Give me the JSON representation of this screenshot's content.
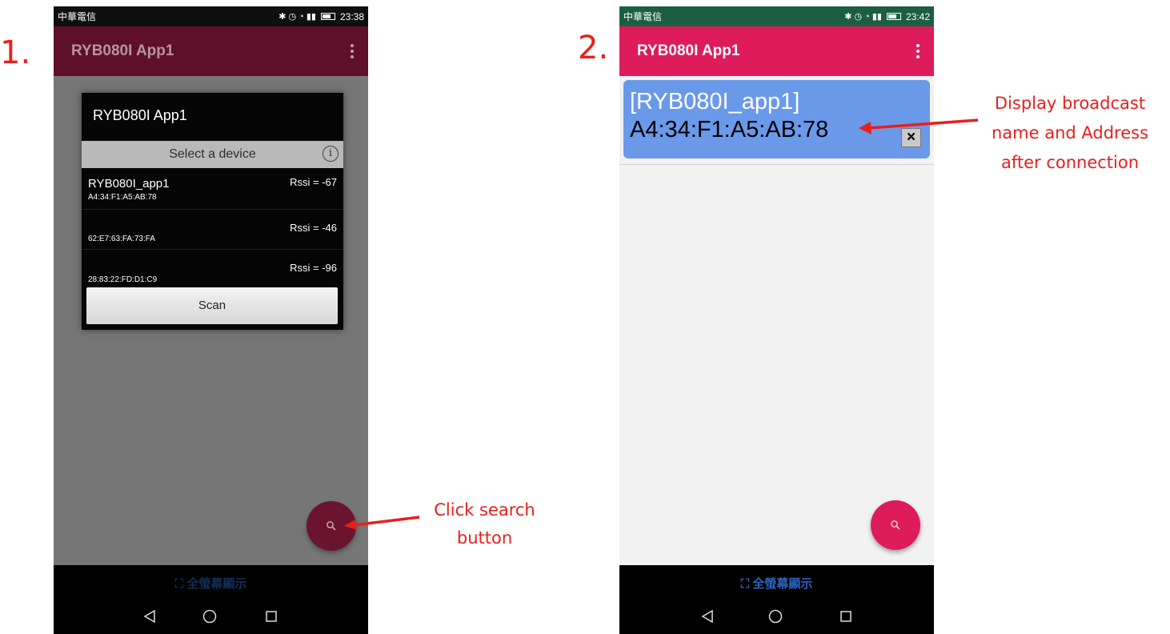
{
  "steps": [
    "1.",
    "2."
  ],
  "annotations": {
    "search_note_line1": "Click search",
    "search_note_line2": "button",
    "display_note_line1": "Display broadcast",
    "display_note_line2": "name and Address",
    "display_note_line3": "after connection"
  },
  "colors": {
    "annotation": "#e8201c",
    "appbar_dimmed": "#5e0f2a",
    "appbar": "#de1b5b",
    "fab_dimmed": "#6b1430",
    "fab": "#de1b5b",
    "connection_card": "#6b99ea"
  },
  "phone1": {
    "status": {
      "carrier": "中華電信",
      "time": "23:38"
    },
    "app_title": "RYB080I App1",
    "dialog": {
      "title": "RYB080I App1",
      "subtitle": "Select a device",
      "devices": [
        {
          "name": "RYB080I_app1",
          "address": "A4:34:F1:A5:AB:78",
          "rssi": "Rssi = -67"
        },
        {
          "name": "",
          "address": "62:E7:63:FA:73:FA",
          "rssi": "Rssi = -46"
        },
        {
          "name": "",
          "address": "28:83:22:FD:D1:C9",
          "rssi": "Rssi = -96"
        }
      ],
      "scan_label": "Scan"
    },
    "fab_icon": "search-icon",
    "fullscreen_label": "全螢幕顯示"
  },
  "phone2": {
    "status": {
      "carrier": "中華電信",
      "time": "23:42"
    },
    "app_title": "RYB080I App1",
    "connection": {
      "name": "[RYB080I_app1]",
      "address": "A4:34:F1:A5:AB:78",
      "close_label": "×"
    },
    "fab_icon": "search-icon",
    "fullscreen_label": "全螢幕顯示"
  }
}
